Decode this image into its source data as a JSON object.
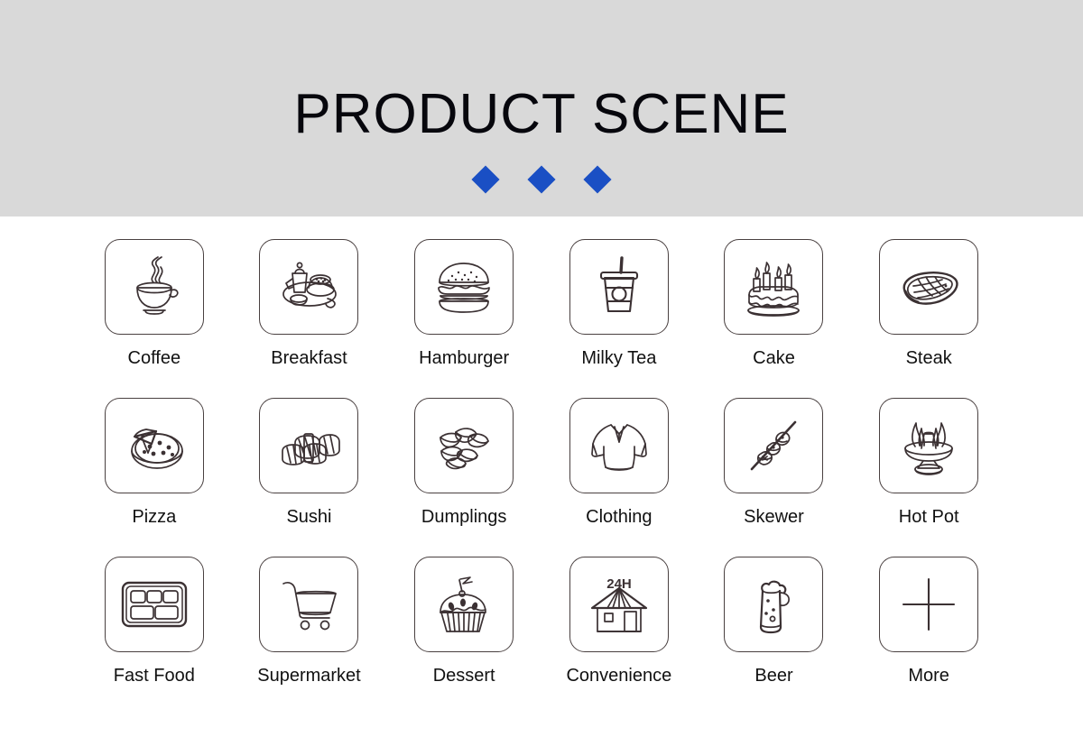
{
  "header": {
    "title": "PRODUCT SCENE",
    "background_color": "#d9d9d9",
    "title_color": "#07070d",
    "diamonds": [
      {
        "name": "diamond-1",
        "color": "#1a4fc4"
      },
      {
        "name": "diamond-2",
        "color": "#1a4fc4"
      },
      {
        "name": "diamond-3",
        "color": "#1a4fc4"
      }
    ]
  },
  "grid": {
    "columns": 6,
    "rows": 3,
    "card_border_color": "#494040",
    "icon_stroke_color": "#3b3133",
    "items": [
      {
        "label": "Coffee",
        "icon": "coffee-cup-icon"
      },
      {
        "label": "Breakfast",
        "icon": "breakfast-tray-icon"
      },
      {
        "label": "Hamburger",
        "icon": "hamburger-icon"
      },
      {
        "label": "Milky Tea",
        "icon": "milky-tea-cup-icon"
      },
      {
        "label": "Cake",
        "icon": "birthday-cake-icon"
      },
      {
        "label": "Steak",
        "icon": "steak-icon"
      },
      {
        "label": "Pizza",
        "icon": "pizza-icon"
      },
      {
        "label": "Sushi",
        "icon": "sushi-icon"
      },
      {
        "label": "Dumplings",
        "icon": "dumplings-icon"
      },
      {
        "label": "Clothing",
        "icon": "shirt-icon"
      },
      {
        "label": "Skewer",
        "icon": "skewer-icon"
      },
      {
        "label": "Hot Pot",
        "icon": "hot-pot-icon"
      },
      {
        "label": "Fast Food",
        "icon": "bento-box-icon"
      },
      {
        "label": "Supermarket",
        "icon": "shopping-cart-icon"
      },
      {
        "label": "Dessert",
        "icon": "cupcake-icon"
      },
      {
        "label": "Convenience",
        "icon": "convenience-store-icon"
      },
      {
        "label": "Beer",
        "icon": "beer-mug-icon"
      },
      {
        "label": "More",
        "icon": "plus-icon"
      }
    ],
    "convenience_store_sign": "24H"
  }
}
